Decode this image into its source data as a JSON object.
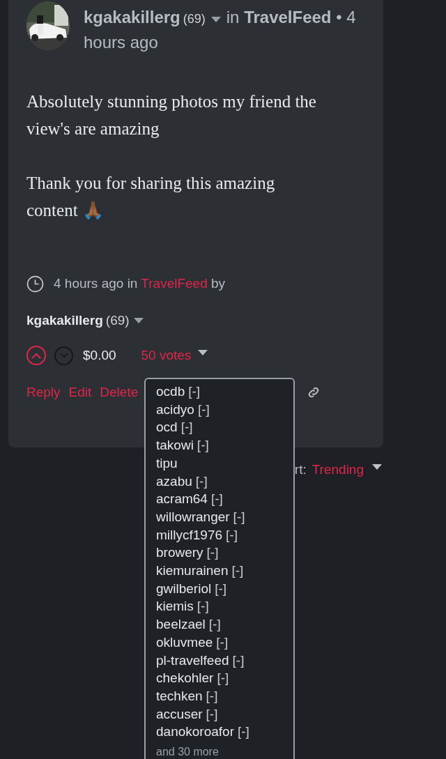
{
  "post": {
    "author": "kgakakillerg",
    "reputation": "(69)",
    "in_word": "in",
    "community": "TravelFeed",
    "time_lines": [
      "• 4",
      "hours ago"
    ],
    "avatar": {
      "kind": "picture"
    },
    "paragraphs": [
      "Absolutely stunning photos my friend the view's are amazing",
      "Thank you for sharing this amazing content 🙏🏾"
    ],
    "footer": {
      "time": "4 hours ago in",
      "community": "TravelFeed",
      "by": "by"
    },
    "byline": {
      "author": "kgakakillerg",
      "reputation": "(69)"
    },
    "upvoted": true,
    "downvoted": false,
    "payout": "$0.00",
    "votes_label": "50 votes",
    "actions": [
      "Reply",
      "Edit",
      "Delete"
    ]
  },
  "sort": {
    "label": "rt:",
    "value": "Trending"
  },
  "voters_popup": {
    "voters": [
      {
        "name": "ocdb",
        "unvote": "[-]"
      },
      {
        "name": "acidyo",
        "unvote": "[-]"
      },
      {
        "name": "ocd",
        "unvote": "[-]"
      },
      {
        "name": "takowi",
        "unvote": "[-]"
      },
      {
        "name": "tipu"
      },
      {
        "name": "azabu",
        "unvote": "[-]"
      },
      {
        "name": "acram64",
        "unvote": "[-]"
      },
      {
        "name": "willowranger",
        "unvote": "[-]"
      },
      {
        "name": "millycf1976",
        "unvote": "[-]"
      },
      {
        "name": "browery",
        "unvote": "[-]"
      },
      {
        "name": "kiemurainen",
        "unvote": "[-]"
      },
      {
        "name": "gwilberiol",
        "unvote": "[-]"
      },
      {
        "name": "kiemis",
        "unvote": "[-]"
      },
      {
        "name": "beelzael",
        "unvote": "[-]"
      },
      {
        "name": "okluvmee",
        "unvote": "[-]"
      },
      {
        "name": "pl-travelfeed",
        "unvote": "[-]"
      },
      {
        "name": "chekohler",
        "unvote": "[-]"
      },
      {
        "name": "techken",
        "unvote": "[-]"
      },
      {
        "name": "accuser",
        "unvote": "[-]"
      },
      {
        "name": "danokoroafor",
        "unvote": "[-]"
      }
    ],
    "more": "and 30 more"
  }
}
